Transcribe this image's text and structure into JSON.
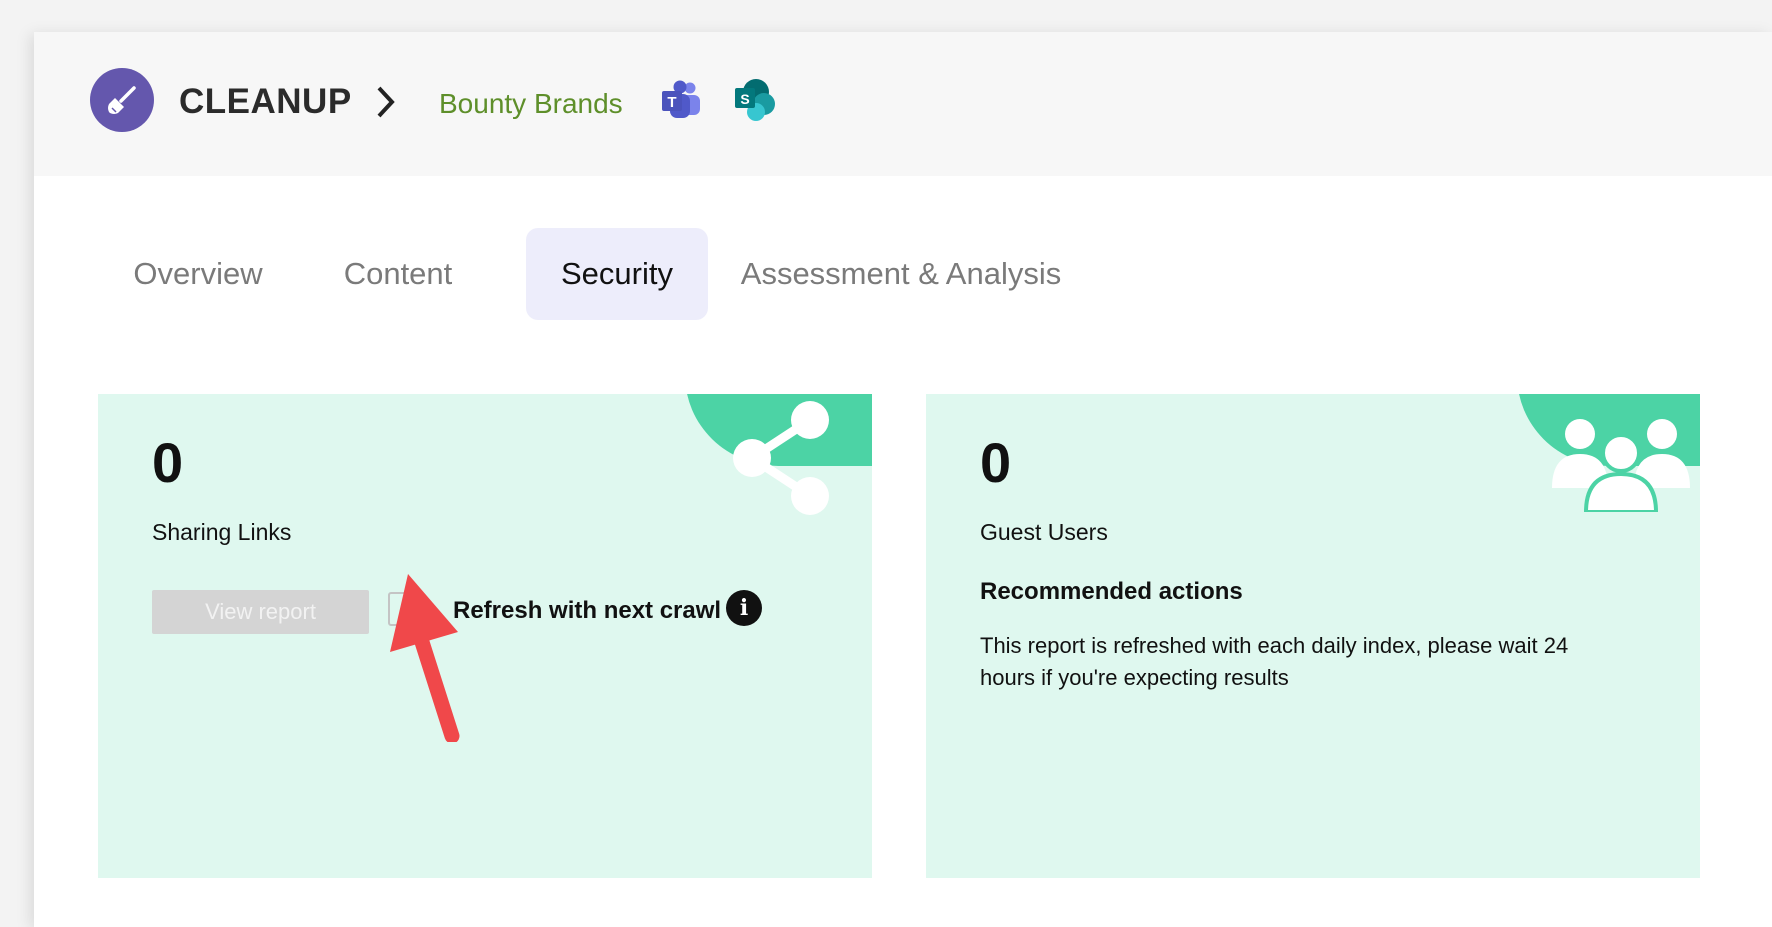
{
  "header": {
    "app_name": "CLEANUP",
    "breadcrumb_site": "Bounty Brands",
    "teams_icon": "microsoft-teams-icon",
    "sharepoint_icon": "sharepoint-icon",
    "logo_icon": "broom-icon"
  },
  "tabs": [
    {
      "label": "Overview",
      "active": false
    },
    {
      "label": "Content",
      "active": false
    },
    {
      "label": "Security",
      "active": true
    },
    {
      "label": "Assessment & Analysis",
      "active": false
    }
  ],
  "cards": {
    "sharing_links": {
      "count": "0",
      "label": "Sharing Links",
      "icon": "share-icon",
      "view_report_label": "View report",
      "refresh_label": "Refresh with next crawl",
      "refresh_checked": false,
      "info_glyph": "i"
    },
    "guest_users": {
      "count": "0",
      "label": "Guest Users",
      "icon": "users-group-icon",
      "recommended_title": "Recommended actions",
      "recommended_text": "This report is refreshed with each daily index, please wait 24 hours if you're expecting results"
    }
  },
  "colors": {
    "accent_purple": "#6457ad",
    "site_green": "#5e8f2a",
    "card_bg": "#dff8ef",
    "badge_green": "#4cd3a5",
    "active_tab_bg": "#ededfb",
    "annotation_arrow": "#f0484a"
  }
}
